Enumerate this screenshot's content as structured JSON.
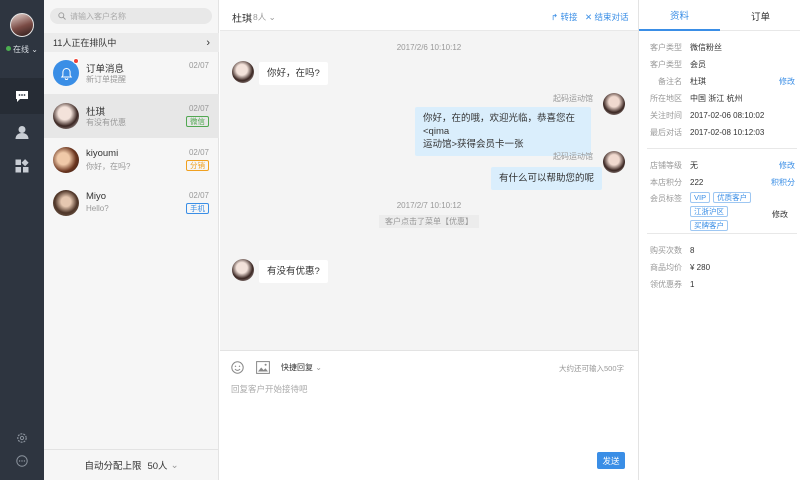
{
  "rail": {
    "status": "在线",
    "icons": [
      "chat-icon",
      "user-icon",
      "apps-icon",
      "settings-icon",
      "more-icon"
    ]
  },
  "list": {
    "search_placeholder": "请输入客户名称",
    "queue_text": "11人正在排队中",
    "conversations": [
      {
        "name": "订单消息",
        "preview": "新订单提醒",
        "date": "02/07",
        "tag": "",
        "tag_color": ""
      },
      {
        "name": "杜琪",
        "preview": "有没有优惠",
        "date": "02/07",
        "tag": "微信",
        "tag_color": "#52a852"
      },
      {
        "name": "kiyoumi",
        "preview": "你好，在吗?",
        "date": "02/07",
        "tag": "分销",
        "tag_color": "#f0a020"
      },
      {
        "name": "Miyo",
        "preview": "Hello?",
        "date": "02/07",
        "tag": "手机",
        "tag_color": "#3a8ee6"
      }
    ],
    "footer_label": "自动分配上限",
    "footer_value": "50人"
  },
  "chat": {
    "title": "杜琪",
    "count": "8人",
    "transfer": "转接",
    "end": "结束对话",
    "ts1": "2017/2/6  10:10:12",
    "msg1": "你好，在吗?",
    "sender": "起码运动馆",
    "msg2_line1": "你好，在的哦，欢迎光临，恭喜您在<qima",
    "msg2_line2": "运动馆>获得会员卡一张",
    "msg3": "有什么可以帮助您的呢",
    "ts2": "2017/2/7  10:10:12",
    "system": "客户点击了菜单【优惠】",
    "msg4": "有没有优惠?",
    "quick_reply": "快捷回复",
    "char_limit": "大约还可输入500字",
    "input_placeholder": "回复客户开始接待吧",
    "send": "发送"
  },
  "info": {
    "tabs": [
      "资料",
      "订单"
    ],
    "section1": [
      {
        "k": "客户类型",
        "v": "微信粉丝",
        "a": ""
      },
      {
        "k": "客户类型",
        "v": "会员",
        "a": ""
      },
      {
        "k": "备注名",
        "v": "杜琪",
        "a": "修改"
      },
      {
        "k": "所在地区",
        "v": "中国 浙江 杭州",
        "a": ""
      },
      {
        "k": "关注时间",
        "v": "2017-02-06 08:10:02",
        "a": ""
      },
      {
        "k": "最后对话",
        "v": "2017-02-08 10:12:03",
        "a": ""
      }
    ],
    "section2": [
      {
        "k": "店铺等级",
        "v": "无",
        "a": "修改"
      },
      {
        "k": "本店积分",
        "v": "222",
        "a": "积积分"
      }
    ],
    "tags_label": "会员标签",
    "tags": [
      "VIP",
      "优质客户",
      "江浙沪区",
      "买牌客户"
    ],
    "tags_action": "修改",
    "section3": [
      {
        "k": "购买次数",
        "v": "8"
      },
      {
        "k": "商品均价",
        "v": "¥ 280"
      },
      {
        "k": "领优惠券",
        "v": "1"
      }
    ]
  }
}
